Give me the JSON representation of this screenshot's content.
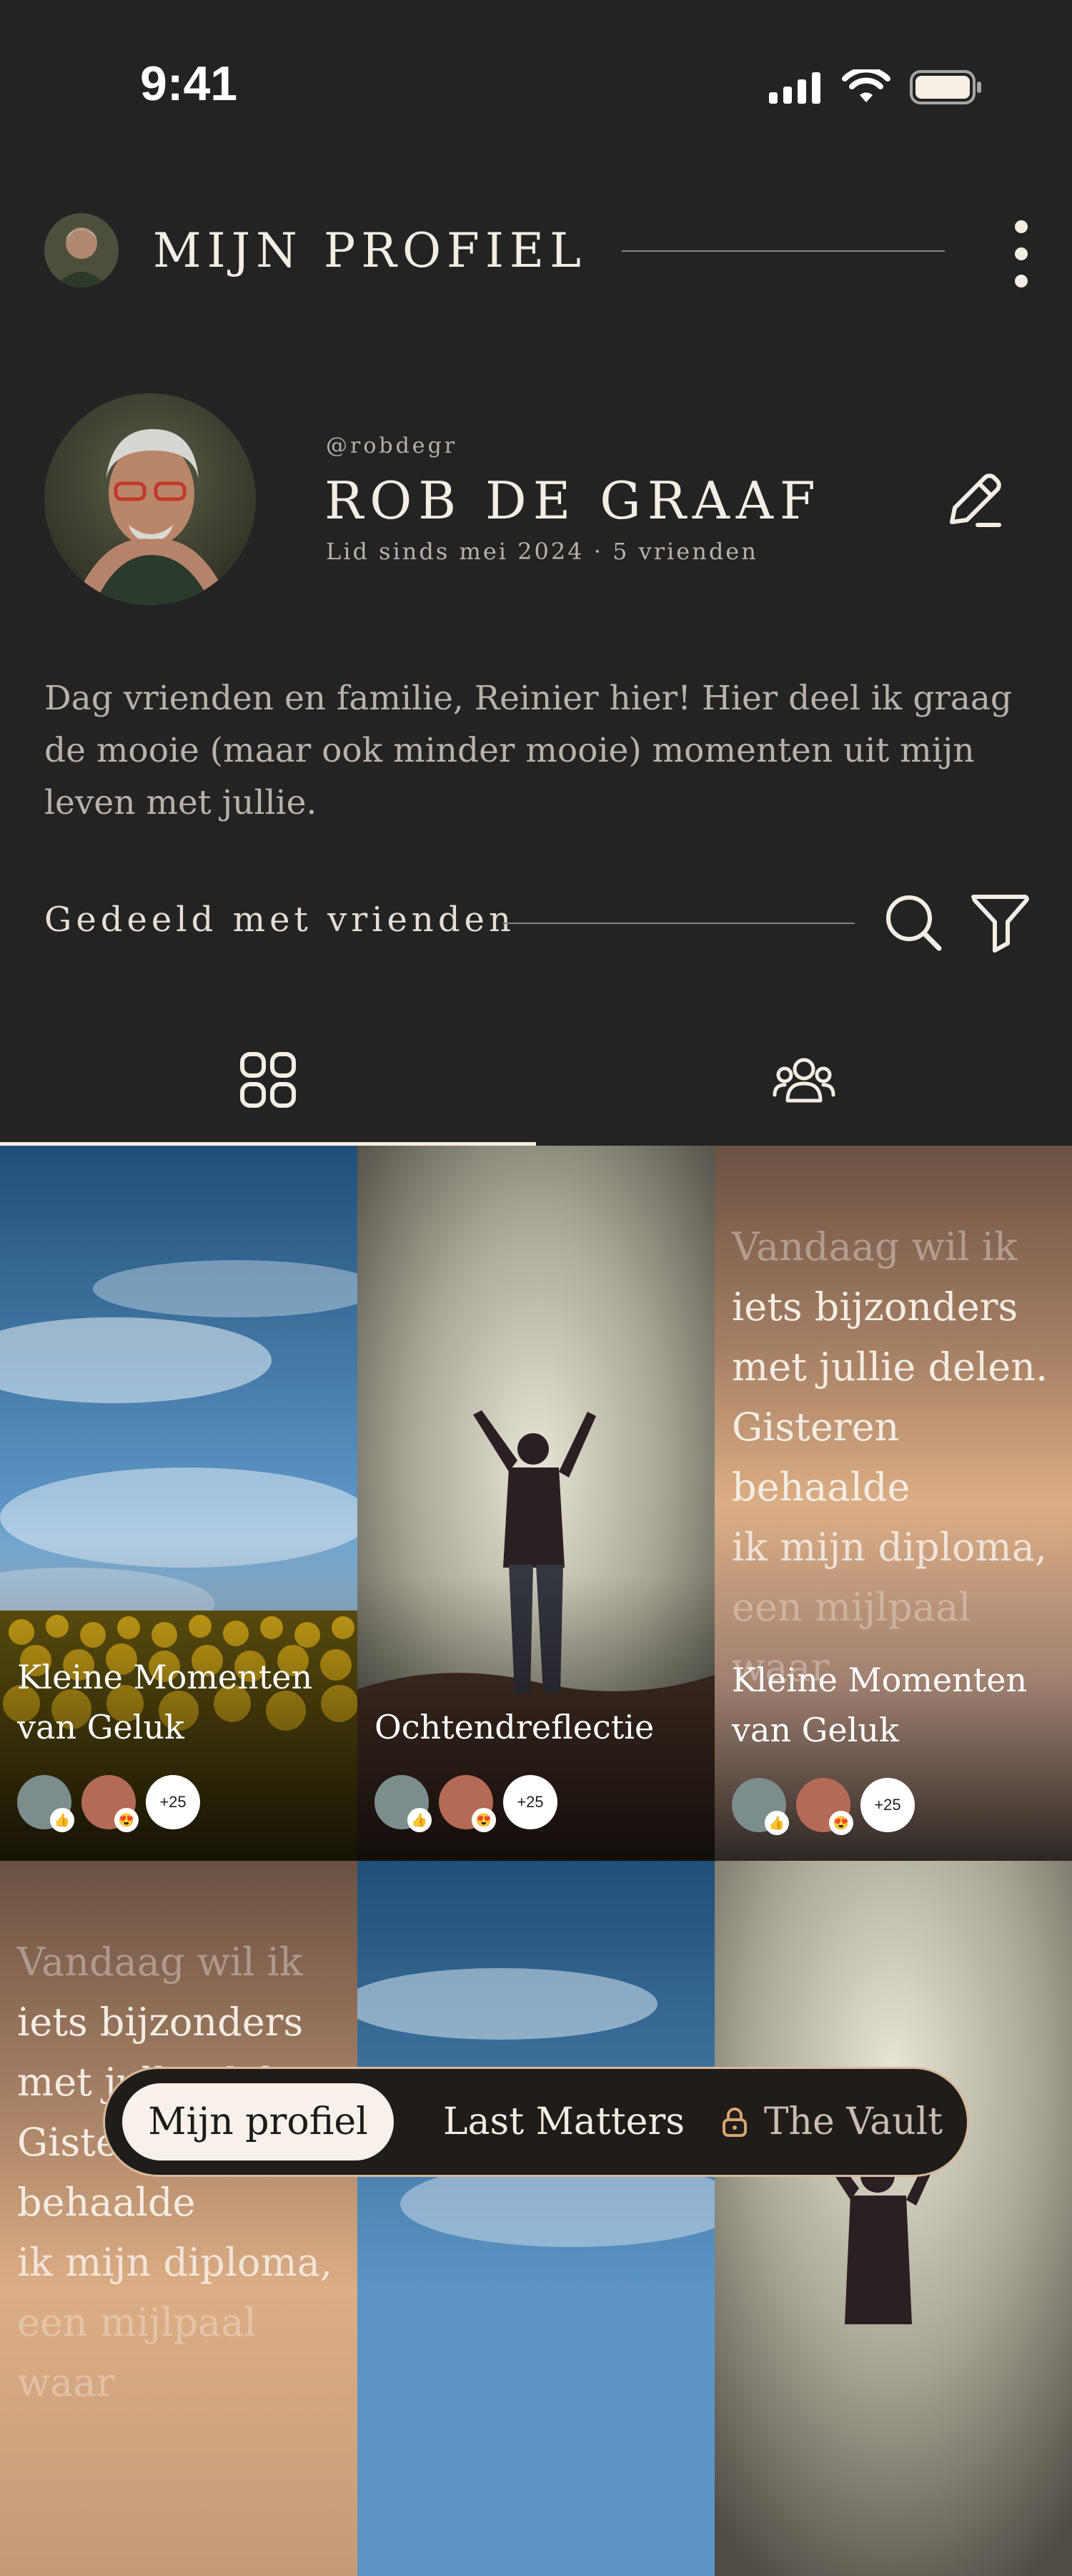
{
  "status_bar": {
    "time": "9:41"
  },
  "header": {
    "title": "MIJN PROFIEL"
  },
  "profile": {
    "handle": "@robdegr",
    "name": "ROB DE GRAAF",
    "meta": "Lid sinds mei 2024 · 5 vrienden",
    "bio": "Dag vrienden en familie, Reinier hier! Hier deel ik graag de mooie (maar ook minder mooie) momenten uit mijn leven met jullie."
  },
  "section": {
    "label": "Gedeeld met vrienden"
  },
  "tabs": [
    {
      "icon": "grid-icon",
      "active": true
    },
    {
      "icon": "group-icon",
      "active": false
    }
  ],
  "posts": [
    {
      "type": "photo",
      "title_line1": "Kleine Momenten",
      "title_line2": "van Geluk",
      "more": "+25"
    },
    {
      "type": "photo",
      "title_line1": "Ochtendreflectie",
      "title_line2": "",
      "more": "+25"
    },
    {
      "type": "text",
      "lines": [
        "Vandaag wil ik",
        "iets bijzonders",
        "met jullie delen.",
        "Gisteren behaalde",
        "ik mijn diploma,",
        "een mijlpaal waar"
      ],
      "title_line1": "Kleine Momenten",
      "title_line2": "van Geluk",
      "more": "+25"
    },
    {
      "type": "text",
      "lines": [
        "Vandaag wil ik",
        "iets bijzonders",
        "met jullie delen.",
        "Gisteren behaalde",
        "ik mijn diploma,",
        "een mijlpaal waar"
      ]
    }
  ],
  "nav": {
    "profile": "Mijn profiel",
    "last_matters": "Last Matters",
    "vault": "The Vault"
  },
  "colors": {
    "background": "#232323",
    "accent": "#d9b89a",
    "text": "#f4ede4"
  }
}
